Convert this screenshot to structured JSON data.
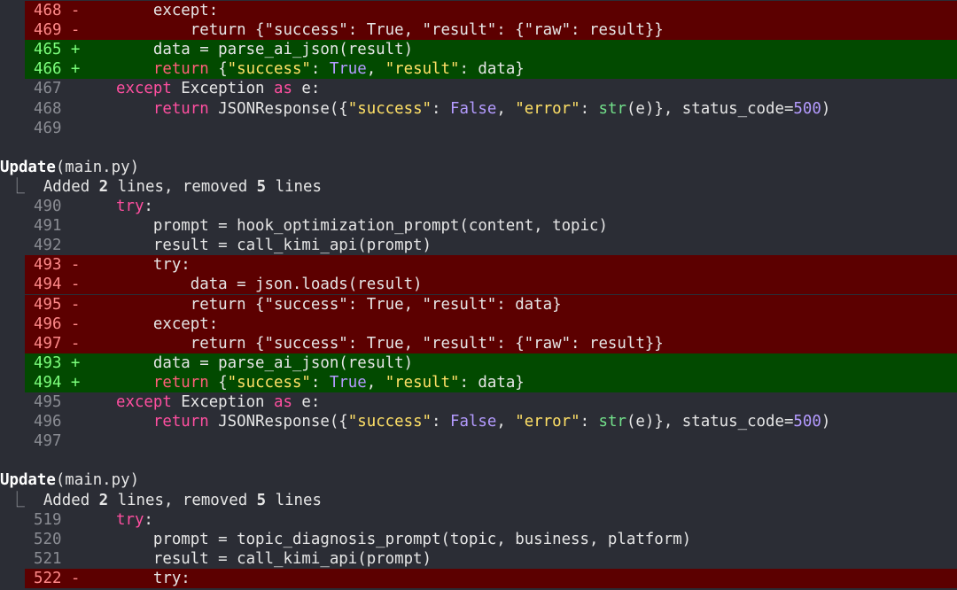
{
  "blocks": [
    {
      "header": null,
      "summary": null,
      "lines": [
        {
          "type": "del",
          "num": "468",
          "sign": "-",
          "indent": "    ",
          "tokens": [
            [
              "",
              "except:"
            ]
          ]
        },
        {
          "type": "del",
          "num": "469",
          "sign": "-",
          "indent": "        ",
          "tokens": [
            [
              "",
              "return {\"success\": True, \"result\": {\"raw\": result}}"
            ]
          ]
        },
        {
          "type": "add",
          "num": "465",
          "sign": "+",
          "indent": "    ",
          "tokens": [
            [
              "",
              "data = parse_ai_json(result)"
            ]
          ]
        },
        {
          "type": "add",
          "num": "466",
          "sign": "+",
          "indent": "    ",
          "tokens": [
            [
              "kw",
              "return"
            ],
            [
              "",
              " {"
            ],
            [
              "str",
              "\"success\""
            ],
            [
              "",
              ": "
            ],
            [
              "bool",
              "True"
            ],
            [
              "",
              ", "
            ],
            [
              "str",
              "\"result\""
            ],
            [
              "",
              ": data}"
            ]
          ]
        },
        {
          "type": "ctx",
          "num": "467",
          "sign": "",
          "indent": "",
          "tokens": [
            [
              "kw",
              "except"
            ],
            [
              "",
              " Exception "
            ],
            [
              "kw",
              "as"
            ],
            [
              "",
              " e:"
            ]
          ]
        },
        {
          "type": "ctx",
          "num": "468",
          "sign": "",
          "indent": "    ",
          "tokens": [
            [
              "kw",
              "return"
            ],
            [
              "",
              " JSONResponse({"
            ],
            [
              "str",
              "\"success\""
            ],
            [
              "",
              ": "
            ],
            [
              "bool",
              "False"
            ],
            [
              "",
              ", "
            ],
            [
              "str",
              "\"error\""
            ],
            [
              "",
              ": "
            ],
            [
              "fn",
              "str"
            ],
            [
              "",
              "(e)}, status_code="
            ],
            [
              "num",
              "500"
            ],
            [
              "",
              ")"
            ]
          ]
        },
        {
          "type": "ctx",
          "num": "469",
          "sign": "",
          "indent": "",
          "tokens": []
        }
      ]
    },
    {
      "header": {
        "tool": "Update",
        "arg": "(main.py)"
      },
      "summary": {
        "a": "Added ",
        "added": "2",
        "b": " lines, removed ",
        "removed": "5",
        "c": " lines"
      },
      "lines": [
        {
          "type": "ctx",
          "num": "490",
          "sign": "",
          "indent": "",
          "tokens": [
            [
              "kw",
              "try"
            ],
            [
              "",
              ":"
            ]
          ]
        },
        {
          "type": "ctx",
          "num": "491",
          "sign": "",
          "indent": "    ",
          "tokens": [
            [
              "",
              "prompt = hook_optimization_prompt(content, topic)"
            ]
          ]
        },
        {
          "type": "ctx",
          "num": "492",
          "sign": "",
          "indent": "    ",
          "tokens": [
            [
              "",
              "result = call_kimi_api(prompt)"
            ]
          ]
        },
        {
          "type": "del",
          "num": "493",
          "sign": "-",
          "indent": "    ",
          "tokens": [
            [
              "",
              "try:"
            ]
          ]
        },
        {
          "type": "del",
          "num": "494",
          "sign": "-",
          "indent": "        ",
          "tokens": [
            [
              "",
              "data = json.loads(result)"
            ]
          ]
        },
        {
          "type": "del",
          "num": "495",
          "sign": "-",
          "indent": "        ",
          "tokens": [
            [
              "",
              "return {\"success\": True, \"result\": data}"
            ]
          ]
        },
        {
          "type": "del",
          "num": "496",
          "sign": "-",
          "indent": "    ",
          "tokens": [
            [
              "",
              "except:"
            ]
          ]
        },
        {
          "type": "del",
          "num": "497",
          "sign": "-",
          "indent": "        ",
          "tokens": [
            [
              "",
              "return {\"success\": True, \"result\": {\"raw\": result}}"
            ]
          ]
        },
        {
          "type": "add",
          "num": "493",
          "sign": "+",
          "indent": "    ",
          "tokens": [
            [
              "",
              "data = parse_ai_json(result)"
            ]
          ]
        },
        {
          "type": "add",
          "num": "494",
          "sign": "+",
          "indent": "    ",
          "tokens": [
            [
              "kw",
              "return"
            ],
            [
              "",
              " {"
            ],
            [
              "str",
              "\"success\""
            ],
            [
              "",
              ": "
            ],
            [
              "bool",
              "True"
            ],
            [
              "",
              ", "
            ],
            [
              "str",
              "\"result\""
            ],
            [
              "",
              ": data}"
            ]
          ]
        },
        {
          "type": "ctx",
          "num": "495",
          "sign": "",
          "indent": "",
          "tokens": [
            [
              "kw",
              "except"
            ],
            [
              "",
              " Exception "
            ],
            [
              "kw",
              "as"
            ],
            [
              "",
              " e:"
            ]
          ]
        },
        {
          "type": "ctx",
          "num": "496",
          "sign": "",
          "indent": "    ",
          "tokens": [
            [
              "kw",
              "return"
            ],
            [
              "",
              " JSONResponse({"
            ],
            [
              "str",
              "\"success\""
            ],
            [
              "",
              ": "
            ],
            [
              "bool",
              "False"
            ],
            [
              "",
              ", "
            ],
            [
              "str",
              "\"error\""
            ],
            [
              "",
              ": "
            ],
            [
              "fn",
              "str"
            ],
            [
              "",
              "(e)}, status_code="
            ],
            [
              "num",
              "500"
            ],
            [
              "",
              ")"
            ]
          ]
        },
        {
          "type": "ctx",
          "num": "497",
          "sign": "",
          "indent": "",
          "tokens": []
        }
      ]
    },
    {
      "header": {
        "tool": "Update",
        "arg": "(main.py)"
      },
      "summary": {
        "a": "Added ",
        "added": "2",
        "b": " lines, removed ",
        "removed": "5",
        "c": " lines"
      },
      "lines": [
        {
          "type": "ctx",
          "num": "519",
          "sign": "",
          "indent": "",
          "tokens": [
            [
              "kw",
              "try"
            ],
            [
              "",
              ":"
            ]
          ]
        },
        {
          "type": "ctx",
          "num": "520",
          "sign": "",
          "indent": "    ",
          "tokens": [
            [
              "",
              "prompt = topic_diagnosis_prompt(topic, business, platform)"
            ]
          ]
        },
        {
          "type": "ctx",
          "num": "521",
          "sign": "",
          "indent": "    ",
          "tokens": [
            [
              "",
              "result = call_kimi_api(prompt)"
            ]
          ]
        },
        {
          "type": "del",
          "num": "522",
          "sign": "-",
          "indent": "    ",
          "tokens": [
            [
              "",
              "try:"
            ]
          ]
        }
      ]
    }
  ],
  "colors": {
    "background": "#2b2d35",
    "deleted_row": "#5c0000",
    "added_row": "#024a00",
    "keyword": "#ff4fa0",
    "string": "#ffe066",
    "constant": "#b49bff",
    "builtin": "#72e08a"
  }
}
